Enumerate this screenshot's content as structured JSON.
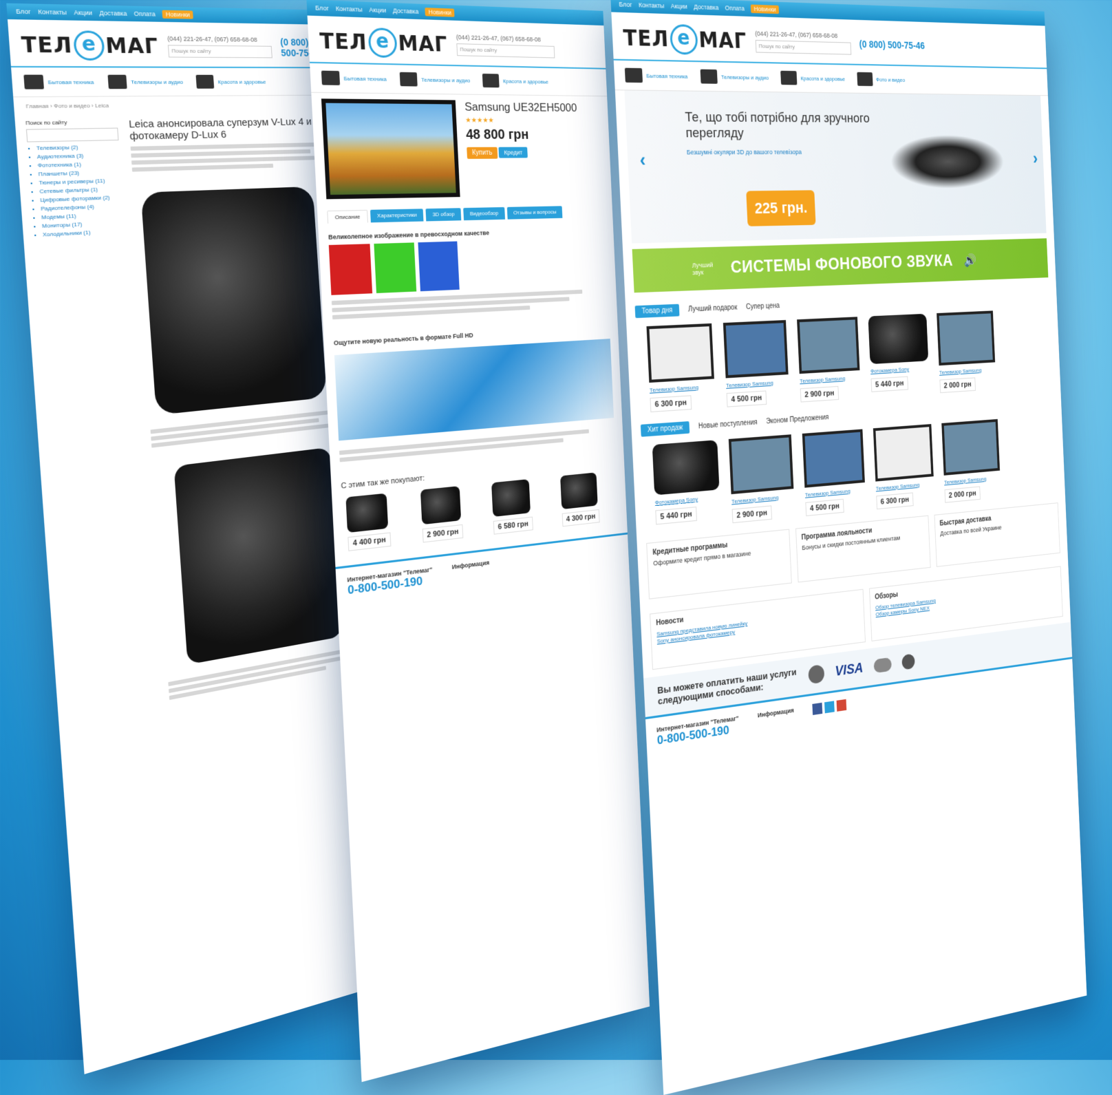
{
  "brand": {
    "logo_left": "ТЕЛ",
    "logo_e": "е",
    "logo_right": "МАГ"
  },
  "phones": "(044) 221-26-47, (067) 658-68-08",
  "hotline": "(0 800) 500-75-46",
  "search_placeholder": "Пошук по сайту",
  "topnav": [
    "Блог",
    "Контакты",
    "Акции",
    "Доставка",
    "Оплата",
    "Новинки"
  ],
  "categories": [
    {
      "label": "Бытовая техника"
    },
    {
      "label": "Телевизоры и аудио"
    },
    {
      "label": "Красота и здоровье"
    },
    {
      "label": "Фото и видео"
    }
  ],
  "page1": {
    "crumbs": "Главная › Фото и видео › Leica",
    "sidebar_title": "Поиск по сайту",
    "sidebar_items": [
      "Телевизоры (2)",
      "Аудиотехника (3)",
      "Фототехника (1)",
      "Планшеты (23)",
      "Тюнеры и ресиверы (11)",
      "Сетевые фильтры (1)",
      "Цифровые фоторамки (2)",
      "Радиотелефоны (4)",
      "Модемы (11)",
      "Мониторы (17)",
      "Холодильники (1)"
    ],
    "title": "Leica анонсировала суперзум V-Lux 4 и фотокамеру D-Lux 6"
  },
  "page2": {
    "product_title": "Samsung UE32EH5000",
    "price": "48 800 грн",
    "buy_label": "Купить",
    "credit_label": "Кредит",
    "tabs": [
      "Описание",
      "Характеристики",
      "3D обзор",
      "Видеообзор",
      "Отзывы и вопросы"
    ],
    "feature1": "Великолепное изображение в превосходном качестве",
    "feature2": "Ощутите новую реальность в формате Full HD",
    "also_bought": "С этим так же покупают:",
    "also_prices": [
      "4 400 грн",
      "2 900 грн",
      "6 580 грн",
      "4 300 грн"
    ],
    "footer_shop": "Интернет-магазин \"Телемаг\"",
    "footer_phone": "0-800-500-190",
    "footer_info": "Информация"
  },
  "page3": {
    "banner_title": "Те, що тобі потрібно для зручного перегляду",
    "banner_sub": "Безшумні окуляри 3D до вашого телевізора",
    "badge": "225 грн.",
    "green_small": "Лучший звук",
    "green_title": "СИСТЕМЫ ФОНОВОГО ЗВУКА",
    "tabs1": [
      "Товар дня",
      "Лучший подарок",
      "Супер цена"
    ],
    "prices1": [
      "6 300 грн",
      "4 500 грн",
      "2 900 грн",
      "5 440 грн",
      "2 000 грн"
    ],
    "tabs2": [
      "Хит продаж",
      "Новые поступления",
      "Эконом Предложения"
    ],
    "prices2": [
      "5 440 грн",
      "2 900 грн",
      "4 500 грн",
      "6 300 грн",
      "2 000 грн"
    ],
    "info": [
      {
        "title": "Кредитные программы",
        "text": "Оформите кредит прямо в магазине"
      },
      {
        "title": "Программа лояльности",
        "text": "Бонусы и скидки постоянным клиентам"
      },
      {
        "title": "Быстрая доставка",
        "text": "Доставка по всей Украине"
      }
    ],
    "news_title": "Новости",
    "reviews_title": "Обзоры",
    "pay_text": "Вы можете оплатить наши услуги следующими способами:",
    "visa": "VISA",
    "footer_shop": "Интернет-магазин \"Телемаг\"",
    "footer_phone": "0-800-500-190",
    "footer_info": "Информация"
  },
  "colors": {
    "accent": "#2aa0db",
    "orange": "#f39a1e",
    "green": "#8cc83a"
  }
}
